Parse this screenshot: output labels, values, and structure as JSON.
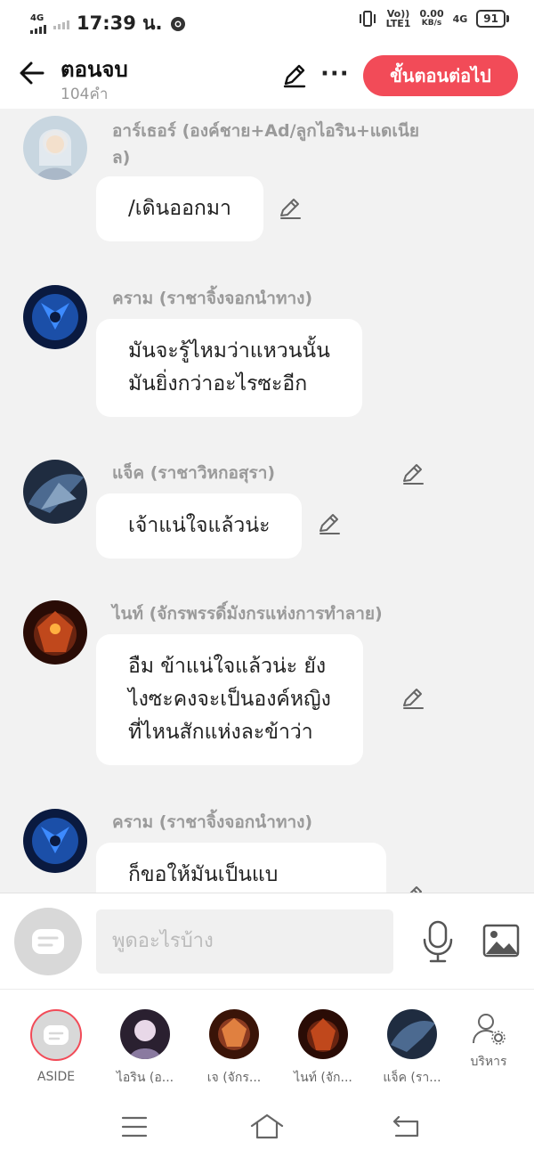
{
  "status": {
    "net_left": "4G",
    "time": "17:39 น.",
    "volte": "Vo))",
    "lte": "LTE1",
    "speed_value": "0.00",
    "speed_unit": "KB/s",
    "net_right": "4G",
    "battery": "91"
  },
  "header": {
    "title": "ตอนจบ",
    "word_count": "104คำ",
    "next_label": "ขั้นตอนต่อไป",
    "more_label": "···"
  },
  "messages": [
    {
      "name": "อาร์เธอร์ (องค์ชาย+Ad/ลูกไอริน+แดเนียล)",
      "text": "/เดินออกมา",
      "avatar_color": "#b8c8d6"
    },
    {
      "name": "คราม (ราชาจิ้งจอกนำทาง)",
      "text": "มันจะรู้ไหมว่าแหวนนั้น\nมันยิ่งกว่าอะไรซะอีก",
      "avatar_color": "#1b4fa8"
    },
    {
      "name": "แจ็ค (ราชาวิหกอสุรา)",
      "text": "เจ้าแน่ใจแล้วน่ะ",
      "avatar_color": "#3b5478"
    },
    {
      "name": "ไนท์ (จักรพรรดิ์มังกรแห่งการทำลาย)",
      "text": "อืม ข้าแน่ใจแล้วน่ะ ยัง\nไงซะคงจะเป็นองค์หญิง\nที่ไหนสักแห่งละข้าว่า",
      "avatar_color": "#6a2410"
    },
    {
      "name": "คราม (ราชาจิ้งจอกนำทาง)",
      "text": "ก็ขอให้มันเป็นแบ",
      "avatar_color": "#1b4fa8"
    }
  ],
  "composer": {
    "placeholder": "พูดอะไรบ้าง"
  },
  "characters": [
    {
      "label": "ASIDE"
    },
    {
      "label": "ไอริน (อ...",
      "avatar_color": "#8a7aa0"
    },
    {
      "label": "เจ (จักร...",
      "avatar_color": "#8a3a20"
    },
    {
      "label": "ไนท์ (จัก...",
      "avatar_color": "#6a2410"
    },
    {
      "label": "แจ็ค (รา...",
      "avatar_color": "#3b5478"
    },
    {
      "label": "บริหาร"
    }
  ],
  "colors": {
    "accent": "#f24b58",
    "name_grey": "#9a9a9a",
    "background": "#f2f2f2"
  }
}
